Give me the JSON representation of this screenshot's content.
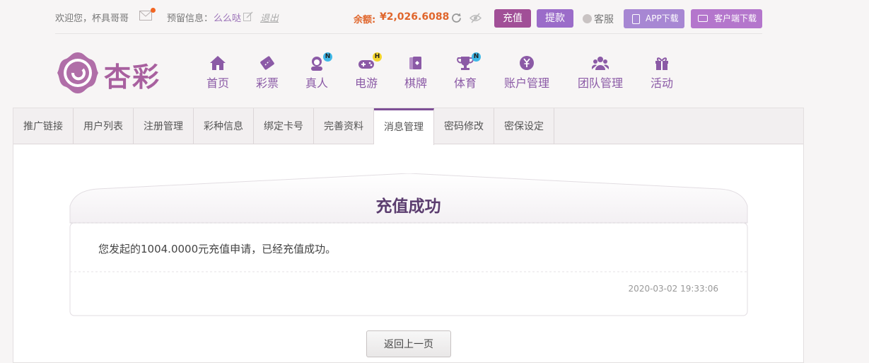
{
  "topbar": {
    "welcome": "欢迎您，杯具哥哥",
    "reserved_label": "预留信息：",
    "reserved_value": "么么哒",
    "logout": "退出",
    "balance_label": "余额:",
    "balance_value": "¥2,026.6088",
    "recharge": "充值",
    "withdraw": "提款",
    "service": "客服",
    "app_download": "APP下载",
    "client_download": "客户端下载"
  },
  "logo": {
    "text": "杏彩"
  },
  "nav": [
    {
      "label": "首页",
      "icon": "home-icon"
    },
    {
      "label": "彩票",
      "icon": "ticket-icon"
    },
    {
      "label": "真人",
      "icon": "dealer-icon",
      "badge": "N"
    },
    {
      "label": "电游",
      "icon": "gamepad-icon",
      "badge": "H"
    },
    {
      "label": "棋牌",
      "icon": "cards-icon"
    },
    {
      "label": "体育",
      "icon": "trophy-icon",
      "badge": "N"
    },
    {
      "label": "账户管理",
      "icon": "yen-icon"
    },
    {
      "label": "团队管理",
      "icon": "team-icon"
    },
    {
      "label": "活动",
      "icon": "gift-icon"
    }
  ],
  "tabs": [
    "推广链接",
    "用户列表",
    "注册管理",
    "彩种信息",
    "绑定卡号",
    "完善资料",
    "消息管理",
    "密码修改",
    "密保设定"
  ],
  "active_tab_index": 6,
  "message": {
    "title": "充值成功",
    "body": "您发起的1004.0000元充值申请，已经充值成功。",
    "time": "2020-03-02 19:33:06"
  },
  "back_button": "返回上一页",
  "colors": {
    "brand": "#a8609f",
    "nav": "#8b5aa6",
    "balance": "#e0662c",
    "recharge": "#a14f97",
    "withdraw": "#9b6cc9"
  }
}
